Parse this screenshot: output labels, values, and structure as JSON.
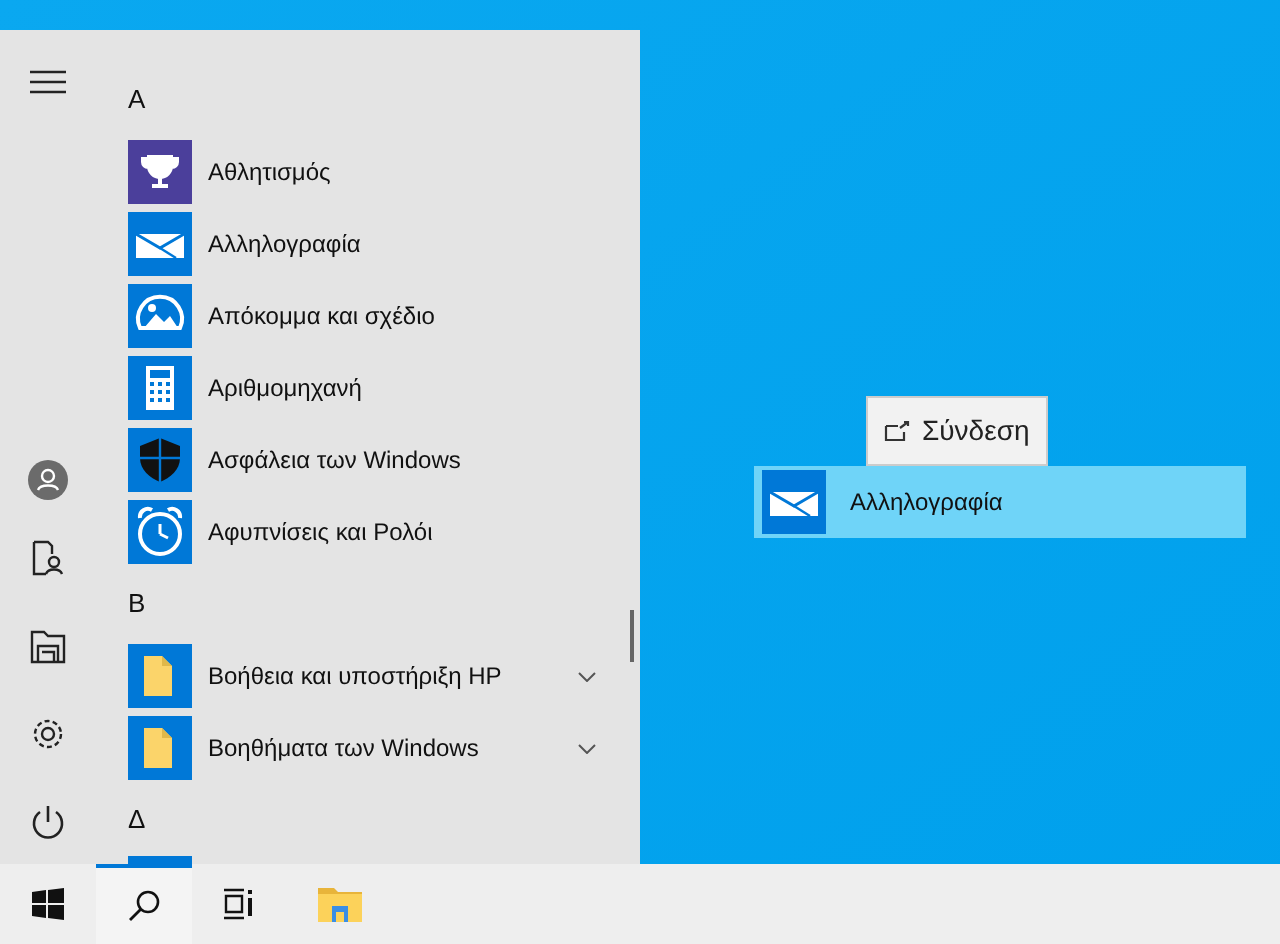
{
  "start_menu": {
    "sections": [
      {
        "letter": "Α",
        "apps": [
          {
            "name": "Αθλητισμός",
            "kind": "trophy",
            "expandable": false
          },
          {
            "name": "Αλληλογραφία",
            "kind": "mail",
            "expandable": false
          },
          {
            "name": "Απόκομμα και σχέδιο",
            "kind": "snip",
            "expandable": false
          },
          {
            "name": "Αριθμομηχανή",
            "kind": "calculator",
            "expandable": false
          },
          {
            "name": "Ασφάλεια των Windows",
            "kind": "shield",
            "expandable": false
          },
          {
            "name": "Αφυπνίσεις και Ρολόι",
            "kind": "clock",
            "expandable": false
          }
        ]
      },
      {
        "letter": "Β",
        "apps": [
          {
            "name": "Βοήθεια και υποστήριξη HP",
            "kind": "folder",
            "expandable": true
          },
          {
            "name": "Βοηθήματα των Windows",
            "kind": "folder",
            "expandable": true
          }
        ]
      },
      {
        "letter": "Δ"
      }
    ]
  },
  "drag": {
    "tooltip": "Σύνδεση",
    "tile": {
      "name": "Αλληλογραφία",
      "kind": "mail"
    }
  }
}
